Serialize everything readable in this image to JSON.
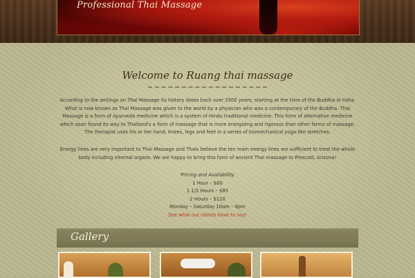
{
  "header": {
    "tagline": "Professional Thai Massage"
  },
  "main": {
    "welcome_title": "Welcome to Ruang thai massage",
    "paragraph_1": "According to the writings on Thai Massage its history dates back over 2500 years; starting at the time of the Buddha in India. What is now known as Thai Massage was given to the world by a physician who was a contemporary of the Buddha. Thai Massage is a form of Ayurveda medicine which is a system of Hindu traditional medicine. This form of alternative medicine which soon found its way to Thailand's a form of massage that is more energizing and rigorous than other forms of massage. The therapist uses his or her hand, knees, legs and feet in a series of biomechanical yoga-like stretches.",
    "paragraph_2": "Energy lines are very important to Thai Massage and Thais believe the ten main energy lines are sufficient to treat the whole body including internal organs. We are happy to bring this form of ancient Thai massage to Prescott, Arizona!",
    "pricing": {
      "heading": "Pricing and Availability",
      "items": [
        "1 Hour – $60",
        "1 1/2 Hours – $85",
        "2 Hours – $110",
        "Monday – Saturday 10am – 6pm"
      ],
      "testimonials_link": "See what our clients have to say!"
    }
  },
  "gallery": {
    "title": "Gallery"
  },
  "colors": {
    "banner_red": "#b11a10",
    "parchment": "#b9b690",
    "link": "#b43a1c",
    "wood": "#4a2f1a"
  }
}
